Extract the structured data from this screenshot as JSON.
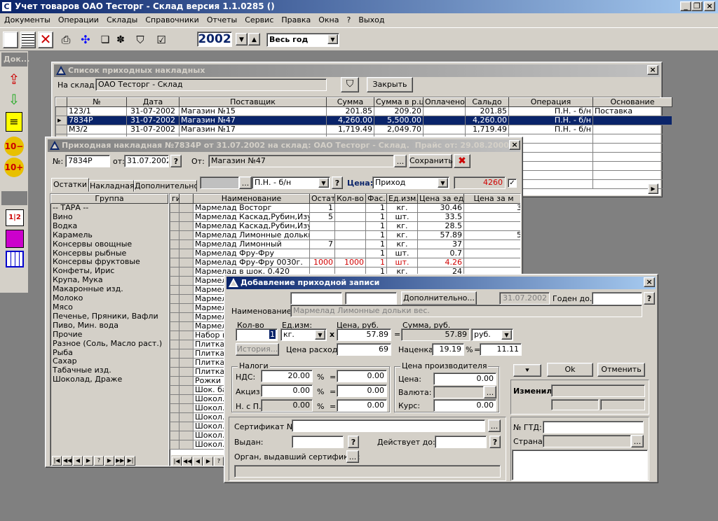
{
  "app": {
    "title": "Учет товаров ОАО Тесторг - Склад версия 1.1.0285 ()"
  },
  "menu": [
    "Документы",
    "Операции",
    "Склады",
    "Справочники",
    "Отчеты",
    "Сервис",
    "Правка",
    "Окна",
    "?",
    "Выход"
  ],
  "toolbar": {
    "year": "2002",
    "period": "Весь год"
  },
  "side_panel": {
    "title": "Док..."
  },
  "invoice_list": {
    "title": "Список приходных накладных",
    "warehouse_label": "На склад:",
    "warehouse_value": "ОАО Тесторг - Склад",
    "close_label": "Закрыть",
    "columns": [
      "№",
      "Дата",
      "Поставщик",
      "Сумма",
      "Сумма в р.ц.",
      "Оплачено",
      "Сальдо",
      "Операция",
      "Основание"
    ],
    "rows": [
      [
        "123/1",
        "31-07-2002",
        "Магазин №15",
        "201.85",
        "209.20",
        "",
        "201.85",
        "П.Н. - б/н",
        "Поставка"
      ],
      [
        "7834Р",
        "31-07-2002",
        "Магазин №47",
        "4,260.00",
        "5,500.00",
        "",
        "4,260.00",
        "П.Н. - б/н",
        ""
      ],
      [
        "М3/2",
        "31-07-2002",
        "Магазин №17",
        "1,719.49",
        "2,049.70",
        "",
        "1,719.49",
        "П.Н. - б/н",
        ""
      ]
    ]
  },
  "invoice": {
    "title": "Приходная накладная №7834Р от 31.07.2002 на склад: ОАО Тесторг - Склад.",
    "title_price": "Прайс от: 29.08.2000",
    "num_label": "№:",
    "num": "7834Р",
    "from_label": "от:",
    "date": "31.07.2002",
    "supplier_label": "От:",
    "supplier": "Магазин №47",
    "save_label": "Сохранить",
    "tabs": [
      "Остатки",
      "Накладная",
      "Дополнительно"
    ],
    "operation": "П.Н. - б/н",
    "price_label": "Цена:",
    "price_type": "Приход",
    "total": "4260",
    "group_header": "Группа",
    "groups": [
      "-- ТАРА --",
      "Вино",
      "Водка",
      "Карамель",
      "Консервы овощные",
      "Консервы рыбные",
      "Консервы фруктовые",
      "Конфеты, Ирис",
      "Крупа, Мука",
      "Макаронные изд.",
      "Молоко",
      "Мясо",
      "Печенье, Пряники, Вафли",
      "Пиво, Мин. вода",
      "Прочие",
      "Разное (Соль, Масло раст.)",
      "Рыба",
      "Сахар",
      "Табачные изд.",
      "Шоколад, Драже"
    ],
    "item_columns": [
      "ги",
      "",
      "Наименование",
      "Остатк",
      "Кол-во",
      "Фас.",
      "Ед.изм.",
      "Цена за ед.",
      "Цена за м"
    ],
    "items": [
      [
        "",
        "",
        "Мармелад Восторг",
        "1",
        "",
        "1",
        "кг.",
        "30.46",
        "3"
      ],
      [
        "",
        "",
        "Мармелад Каскад,Рубин,Изумруд",
        "5",
        "",
        "1",
        "шт.",
        "33.5",
        ""
      ],
      [
        "",
        "",
        "Мармелад Каскад,Рубин,Изумруд",
        "",
        "",
        "1",
        "кг.",
        "28.5",
        ""
      ],
      [
        "",
        "",
        "Мармелад Лимонные дольки вес.",
        "",
        "",
        "1",
        "кг.",
        "57.89",
        "5"
      ],
      [
        "",
        "",
        "Мармелад Лимонный",
        "7",
        "",
        "1",
        "кг.",
        "37",
        ""
      ],
      [
        "",
        "",
        "Мармелад Фру-Фру",
        "",
        "",
        "1",
        "шт.",
        "0.7",
        ""
      ],
      [
        "",
        "",
        "Мармелад Фру-Фру 0030г.",
        "1000",
        "1000",
        "1",
        "шт.",
        "4.26",
        ""
      ],
      [
        "",
        "",
        "Мармелад в шок. 0,420",
        "",
        "",
        "1",
        "кг.",
        "24",
        ""
      ],
      [
        "",
        "",
        "Мармел",
        "",
        "",
        "",
        "",
        "",
        ""
      ],
      [
        "",
        "",
        "Мармел",
        "",
        "",
        "",
        "",
        "",
        ""
      ],
      [
        "",
        "",
        "Мармел",
        "",
        "",
        "",
        "",
        "",
        ""
      ],
      [
        "",
        "",
        "Мармел",
        "",
        "",
        "",
        "",
        "",
        ""
      ],
      [
        "",
        "",
        "Мармел",
        "",
        "",
        "",
        "",
        "",
        ""
      ],
      [
        "",
        "",
        "Мармел",
        "",
        "",
        "",
        "",
        "",
        ""
      ],
      [
        "",
        "",
        "Набор н",
        "",
        "",
        "",
        "",
        "",
        ""
      ],
      [
        "",
        "",
        "Плитка",
        "",
        "",
        "",
        "",
        "",
        ""
      ],
      [
        "",
        "",
        "Плитка",
        "",
        "",
        "",
        "",
        "",
        ""
      ],
      [
        "",
        "",
        "Плитка",
        "",
        "",
        "",
        "",
        "",
        ""
      ],
      [
        "",
        "",
        "Плитка",
        "",
        "",
        "",
        "",
        "",
        ""
      ],
      [
        "",
        "",
        "Рожки в",
        "",
        "",
        "",
        "",
        "",
        ""
      ],
      [
        "",
        "",
        "Шок. ба",
        "",
        "",
        "",
        "",
        "",
        ""
      ],
      [
        "",
        "",
        "Шокол.",
        "",
        "",
        "",
        "",
        "",
        ""
      ],
      [
        "",
        "",
        "Шокол.",
        "",
        "",
        "",
        "",
        "",
        ""
      ],
      [
        "",
        "",
        "Шокол.",
        "",
        "",
        "",
        "",
        "",
        ""
      ],
      [
        "",
        "",
        "Шокол.",
        "",
        "",
        "",
        "",
        "",
        ""
      ],
      [
        "",
        "",
        "Шокол.",
        "",
        "",
        "",
        "",
        "",
        ""
      ],
      [
        "",
        "",
        "Шокол.",
        "",
        "",
        "",
        "",
        "",
        ""
      ]
    ]
  },
  "add_record": {
    "title": "Добавление приходной записи",
    "more_label": "Дополнительно...",
    "date": "31.07.2002",
    "valid_label": "Годен до...",
    "name_label": "Наименование:",
    "name": "Мармелад Лимонные дольки вес.",
    "qty_label": "Кол-во",
    "qty": "1",
    "unit_label": "Ед.изм:",
    "unit": "кг.",
    "price_label": "Цена, руб.",
    "price": "57.89",
    "sum_label": "Сумма, руб.",
    "sum": "57.89",
    "currency": "руб.",
    "history_label": "История...",
    "expense_label": "Цена расхода",
    "expense": "69",
    "markup_label": "Наценка:",
    "markup": "19.19",
    "pct": "%",
    "markup_sum": "11.11",
    "ok_label": "Ok",
    "cancel_label": "Отменить",
    "taxes_title": "Налоги",
    "nds_label": "НДС:",
    "nds": "20.00",
    "nds_sum": "0.00",
    "excise_label": "Акциз:",
    "excise": "0.00",
    "excise_sum": "0.00",
    "nsp_label": "Н. с П.:",
    "nsp": "0.00",
    "nsp_sum": "0.00",
    "producer_title": "Цена производителя",
    "prod_price_label": "Цена:",
    "prod_price": "0.00",
    "currency_label": "Валюта:",
    "rate_label": "Курс:",
    "rate": "0.00",
    "changed_label": "Изменил",
    "cert_label": "Сертификат №:",
    "issued_label": "Выдан:",
    "valid_until_label": "Действует до:",
    "organ_label": "Орган, выдавший сертификат:",
    "gtd_label": "№ ГТД:",
    "country_label": "Страна:"
  }
}
